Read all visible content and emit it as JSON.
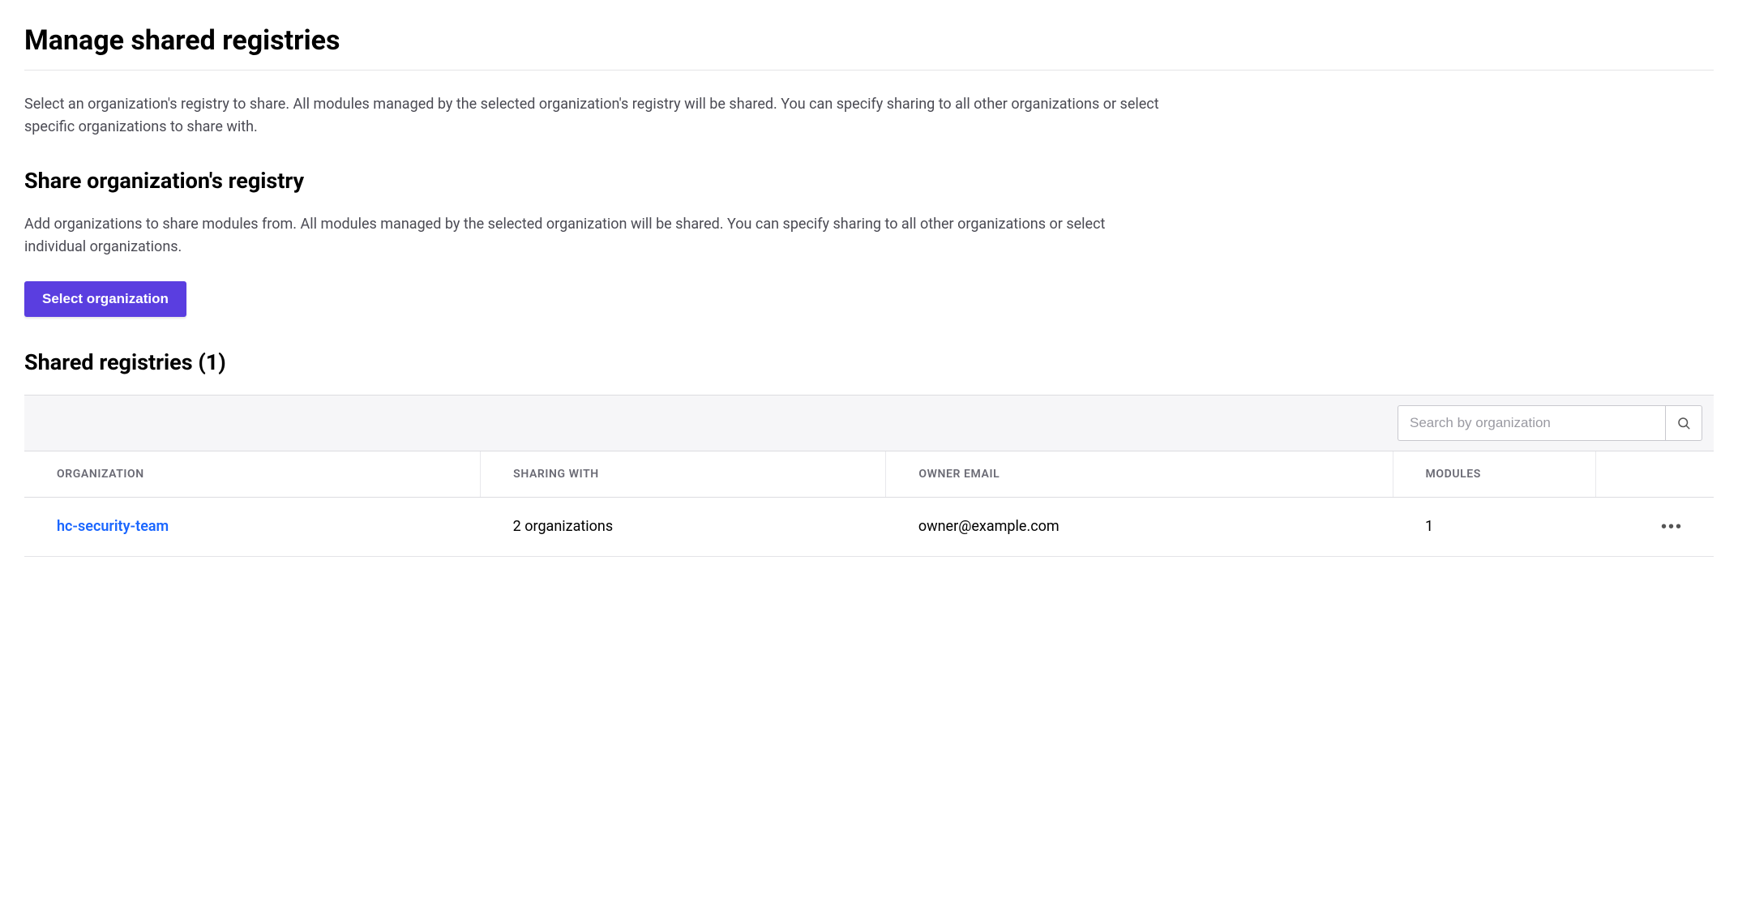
{
  "page": {
    "title": "Manage shared registries",
    "description": "Select an organization's registry to share. All modules managed by the selected organization's registry will be shared. You can specify sharing to all other organizations or select specific organizations to share with."
  },
  "share_section": {
    "title": "Share organization's registry",
    "description": "Add organizations to share modules from. All modules managed by the selected organization will be shared. You can specify sharing to all other organizations or select individual organizations.",
    "button_label": "Select organization"
  },
  "registries_section": {
    "title": "Shared registries (1)",
    "search_placeholder": "Search by organization",
    "columns": {
      "organization": "ORGANIZATION",
      "sharing_with": "SHARING WITH",
      "owner_email": "OWNER EMAIL",
      "modules": "MODULES"
    },
    "rows": [
      {
        "organization": "hc-security-team",
        "sharing_with": "2 organizations",
        "owner_email": "owner@example.com",
        "modules": "1"
      }
    ]
  }
}
